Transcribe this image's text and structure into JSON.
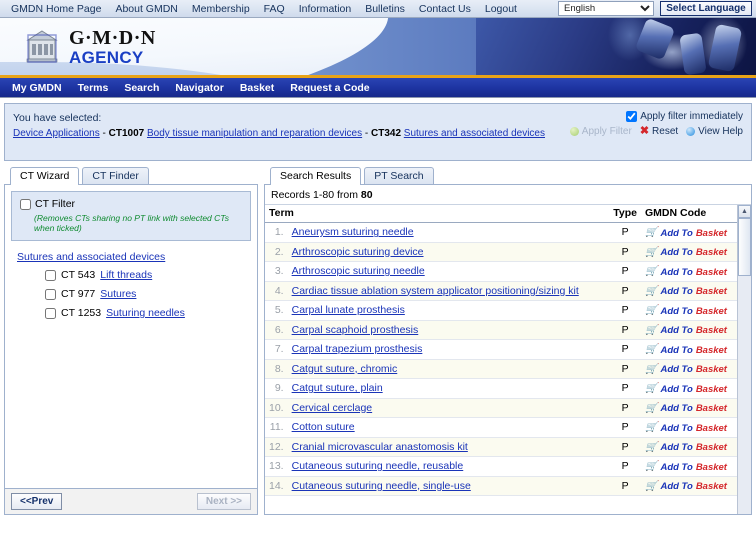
{
  "topnav": {
    "items": [
      {
        "label": "GMDN Home Page"
      },
      {
        "label": "About GMDN"
      },
      {
        "label": "Membership"
      },
      {
        "label": "FAQ"
      },
      {
        "label": "Information"
      },
      {
        "label": "Bulletins"
      },
      {
        "label": "Contact Us"
      },
      {
        "label": "Logout"
      }
    ],
    "language_value": "English",
    "select_language_label": "Select Language"
  },
  "banner": {
    "logo_primary": "G·M·D·N",
    "logo_secondary": "AGENCY"
  },
  "subnav": {
    "items": [
      {
        "label": "My GMDN"
      },
      {
        "label": "Terms"
      },
      {
        "label": "Search"
      },
      {
        "label": "Navigator"
      },
      {
        "label": "Basket"
      },
      {
        "label": "Request a Code"
      }
    ]
  },
  "selection": {
    "title": "You have selected:",
    "breadcrumb": [
      {
        "type": "link",
        "text": "Device Applications"
      },
      {
        "type": "sep",
        "text": " - "
      },
      {
        "type": "code",
        "text": "CT1007"
      },
      {
        "type": "link",
        "text": "Body tissue manipulation and reparation devices"
      },
      {
        "type": "sep",
        "text": " - "
      },
      {
        "type": "code",
        "text": "CT342"
      },
      {
        "type": "link",
        "text": "Sutures and associated devices"
      }
    ],
    "apply_immediately_label": "Apply filter immediately",
    "apply_immediately_checked": true,
    "actions": [
      {
        "label": "Apply Filter",
        "icon": "green-ball-icon",
        "disabled": true
      },
      {
        "label": "Reset",
        "icon": "red-x-icon",
        "disabled": false
      },
      {
        "label": "View Help",
        "icon": "blue-ball-icon",
        "disabled": false
      }
    ]
  },
  "left_panel": {
    "tabs": [
      {
        "label": "CT Wizard",
        "active": true
      },
      {
        "label": "CT Finder",
        "active": false
      }
    ],
    "ct_filter": {
      "label": "CT Filter",
      "checked": false,
      "hint": "(Removes CTs sharing no PT link with selected CTs when ticked)"
    },
    "tree_root": "Sutures and associated devices",
    "tree_items": [
      {
        "code": "CT 543",
        "label": "Lift threads",
        "checked": false
      },
      {
        "code": "CT 977",
        "label": "Sutures",
        "checked": false
      },
      {
        "code": "CT 1253",
        "label": "Suturing needles",
        "checked": false
      }
    ],
    "prev_label": "<<Prev",
    "next_label": "Next >>",
    "prev_disabled": false,
    "next_disabled": true
  },
  "right_panel": {
    "tabs": [
      {
        "label": "Search Results",
        "active": true
      },
      {
        "label": "PT Search",
        "active": false
      }
    ],
    "records_prefix": "Records 1-80 from ",
    "records_total": "80",
    "columns": {
      "term": "Term",
      "type": "Type",
      "code": "GMDN Code"
    },
    "basket_label_1": "Add To",
    "basket_label_2": "Basket",
    "rows": [
      {
        "n": "1.",
        "term": "Aneurysm suturing needle",
        "type": "P"
      },
      {
        "n": "2.",
        "term": "Arthroscopic suturing device",
        "type": "P"
      },
      {
        "n": "3.",
        "term": "Arthroscopic suturing needle",
        "type": "P"
      },
      {
        "n": "4.",
        "term": "Cardiac tissue ablation system applicator positioning/sizing kit",
        "type": "P"
      },
      {
        "n": "5.",
        "term": "Carpal lunate prosthesis",
        "type": "P"
      },
      {
        "n": "6.",
        "term": "Carpal scaphoid prosthesis",
        "type": "P"
      },
      {
        "n": "7.",
        "term": "Carpal trapezium prosthesis",
        "type": "P"
      },
      {
        "n": "8.",
        "term": "Catgut suture, chromic",
        "type": "P"
      },
      {
        "n": "9.",
        "term": "Catgut suture, plain",
        "type": "P"
      },
      {
        "n": "10.",
        "term": "Cervical cerclage",
        "type": "P"
      },
      {
        "n": "11.",
        "term": "Cotton suture",
        "type": "P"
      },
      {
        "n": "12.",
        "term": "Cranial microvascular anastomosis kit",
        "type": "P"
      },
      {
        "n": "13.",
        "term": "Cutaneous suturing needle, reusable",
        "type": "P"
      },
      {
        "n": "14.",
        "term": "Cutaneous suturing needle, single-use",
        "type": "P"
      }
    ]
  }
}
